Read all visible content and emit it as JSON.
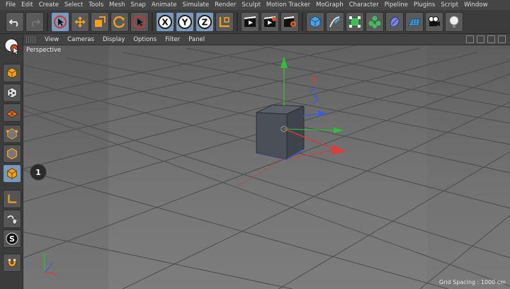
{
  "menu": [
    "File",
    "Edit",
    "Create",
    "Select",
    "Tools",
    "Mesh",
    "Snap",
    "Animate",
    "Simulate",
    "Render",
    "Sculpt",
    "Motion Tracker",
    "MoGraph",
    "Character",
    "Pipeline",
    "Plugins",
    "Script",
    "Window"
  ],
  "toolbar": {
    "icons": [
      "undo-icon",
      "redo-icon",
      "live-selection-icon",
      "move-icon",
      "scale-icon",
      "rotate-icon",
      "select-arrow-icon",
      "x-axis-icon",
      "y-axis-icon",
      "z-axis-icon",
      "coordinate-system-icon",
      "render-view-icon",
      "render-picture-viewer-icon",
      "render-settings-icon",
      "cube-object-icon",
      "pen-spline-icon",
      "subdivision-surface-icon",
      "cloner-icon",
      "deformer-icon",
      "floor-icon",
      "camera-icon",
      "light-icon"
    ],
    "x_label": "X",
    "y_label": "Y",
    "z_label": "Z"
  },
  "left_toolbar": {
    "icons": [
      "make-editable-icon",
      "model-mode-icon",
      "texture-mode-icon",
      "workplane-icon",
      "points-mode-icon",
      "edges-mode-icon",
      "polygons-mode-icon",
      "axis-mode-icon",
      "tweak-mode-icon",
      "snap-icon",
      "magnet-icon"
    ],
    "s_label": "S"
  },
  "viewport": {
    "menu": [
      "View",
      "Cameras",
      "Display",
      "Options",
      "Filter",
      "Panel"
    ],
    "camera_label": "Perspective",
    "grid_spacing": "Grid Spacing : 1000 cm",
    "callout": "1",
    "axis_x": "x",
    "axis_y": "y",
    "axis_z": "z"
  },
  "colors": {
    "accent_active": "#7c9ab8",
    "axis_x": "#e03a3a",
    "axis_y": "#2fbf3a",
    "axis_z": "#3b5be0"
  }
}
